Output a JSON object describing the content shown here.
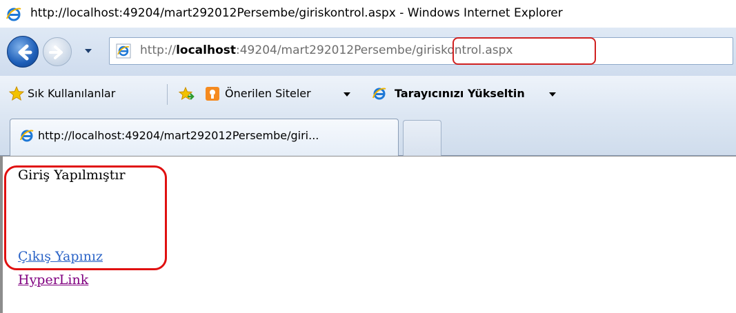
{
  "window": {
    "title": "http://localhost:49204/mart292012Persembe/giriskontrol.aspx - Windows Internet Explorer"
  },
  "address_bar": {
    "scheme": "http://",
    "host": "localhost",
    "rest": ":49204/mart292012Persembe/giriskontrol.aspx"
  },
  "favorites_bar": {
    "favorites_label": "Sık Kullanılanlar",
    "suggested_sites_label": "Önerilen Siteler",
    "upgrade_label": "Tarayıcınızı Yükseltin"
  },
  "tabs": [
    {
      "label": "http://localhost:49204/mart292012Persembe/giri..."
    }
  ],
  "page": {
    "message": "Giriş Yapılmıştır",
    "logout_link": "Çıkış Yapınız",
    "hyperlink": "HyperLink"
  },
  "colors": {
    "highlight": "#e01010",
    "link": "#2a63c7",
    "visited_link": "#800080"
  }
}
